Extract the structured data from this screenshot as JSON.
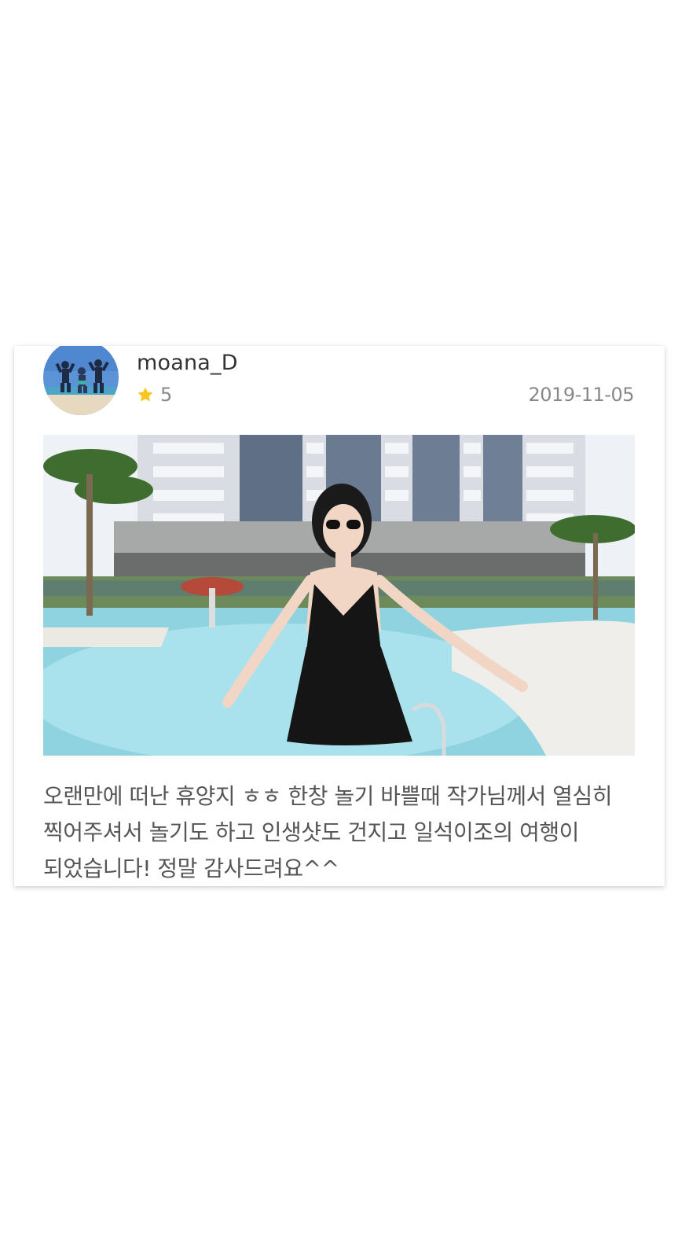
{
  "review": {
    "username": "moana_D",
    "rating": "5",
    "date": "2019-11-05",
    "text": "오랜만에 떠난 휴양지 ㅎㅎ 한창 놀기 바쁠때 작가님께서 열심히 찍어주셔서 놀기도 하고 인생샷도 건지고 일석이조의 여행이 되었습니다! 정말 감사드려요^^"
  },
  "icons": {
    "rating": "star-icon"
  },
  "colors": {
    "star": "#f7c51e",
    "username": "#333333",
    "meta": "#888888",
    "body_text": "#555555"
  }
}
